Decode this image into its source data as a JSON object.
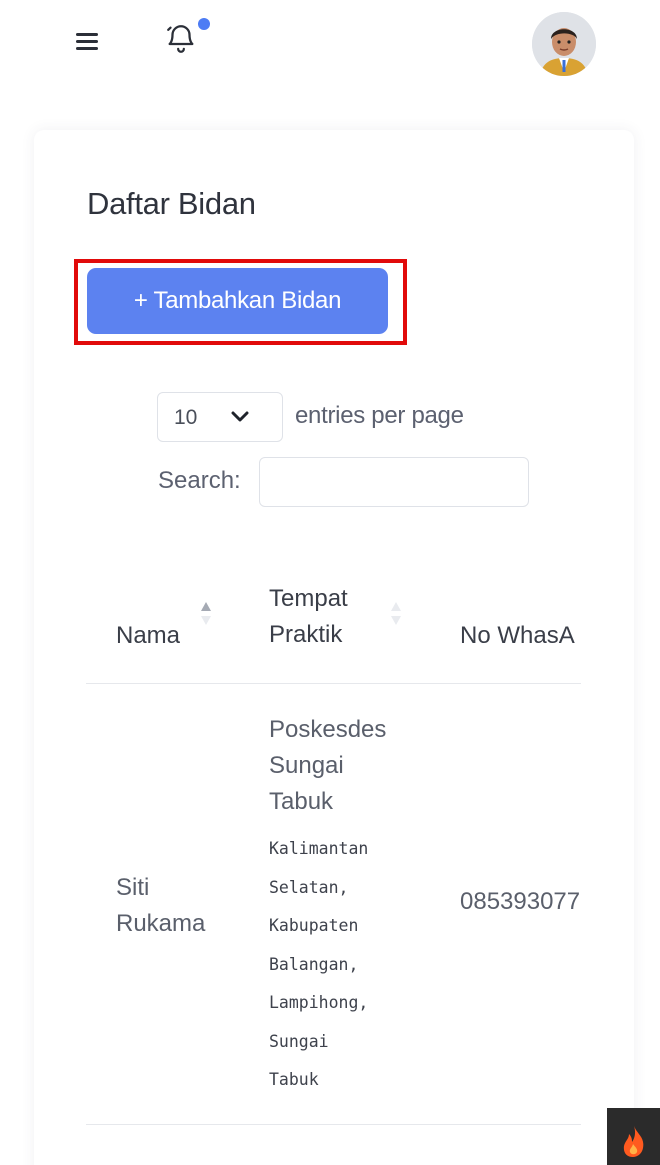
{
  "header": {
    "menu_icon": "hamburger-menu-icon",
    "notification_icon": "bell-icon",
    "notification_dot_color": "#4d7cf4",
    "avatar_icon": "user-avatar"
  },
  "page": {
    "title": "Daftar Bidan",
    "add_button_label": "+ Tambahkan Bidan",
    "add_button_color": "#5c82f0",
    "highlight_color": "#e10a0a"
  },
  "datatable": {
    "entries_value": "10",
    "entries_label": "entries per page",
    "search_label": "Search:",
    "search_value": "",
    "columns": [
      {
        "line1": "Nama",
        "line2": ""
      },
      {
        "line1": "Tempat",
        "line2": "Praktik"
      },
      {
        "line1": "No WhasA",
        "line2": ""
      }
    ],
    "rows": [
      {
        "name_line1": "Siti",
        "name_line2": "Rukama",
        "place": [
          "Poskesdes",
          "Sungai",
          "Tabuk"
        ],
        "address": [
          "Kalimantan",
          "Selatan,",
          "Kabupaten",
          "Balangan,",
          "Lampihong,",
          "Sungai",
          "Tabuk"
        ],
        "phone": "085393077"
      }
    ]
  },
  "floating": {
    "icon": "fire-icon",
    "accent": "#ff5a1f"
  }
}
